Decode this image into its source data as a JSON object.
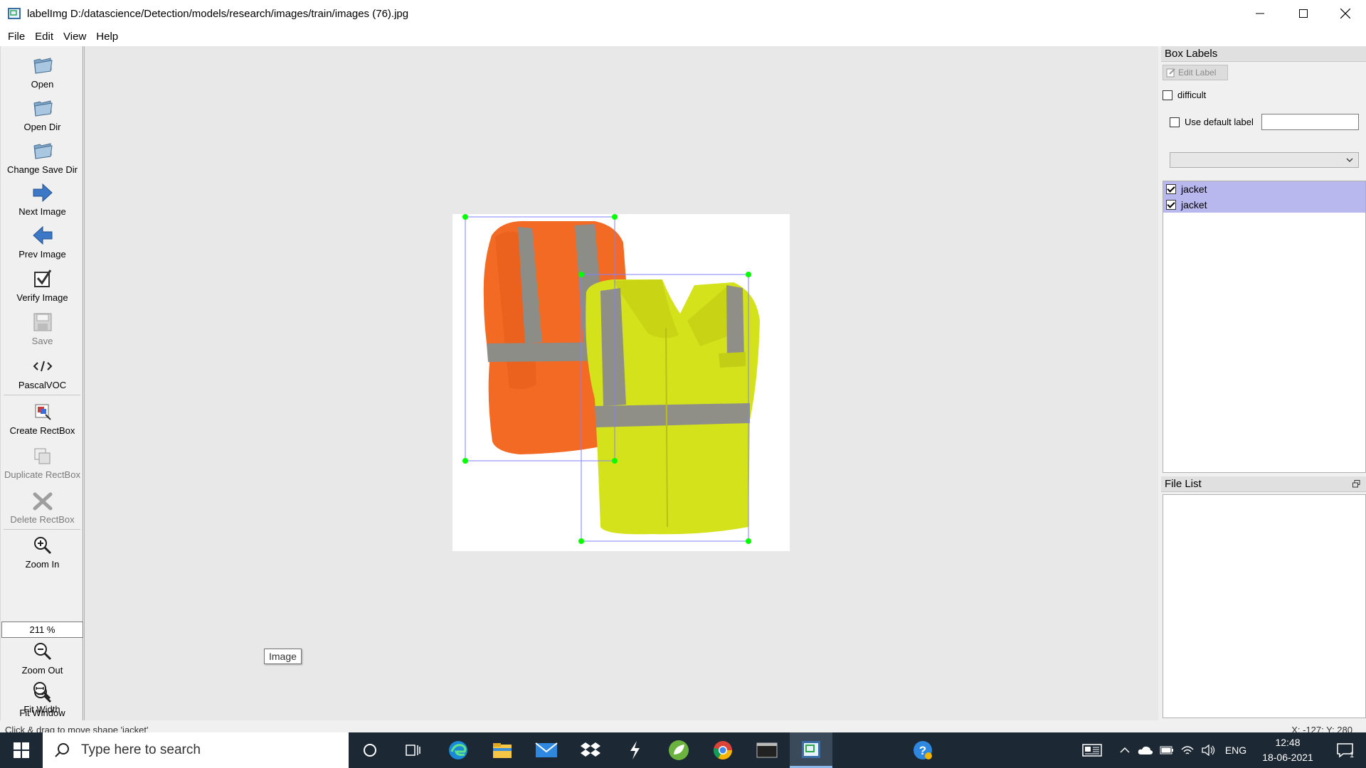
{
  "window": {
    "app_name": "labelImg",
    "title": "labelImg D:/datascience/Detection/models/research/images/train/images (76).jpg"
  },
  "menu": [
    "File",
    "Edit",
    "View",
    "Help"
  ],
  "toolbar": {
    "open": "Open",
    "open_dir": "Open Dir",
    "change_save_dir": "Change Save Dir",
    "next_image": "Next Image",
    "prev_image": "Prev Image",
    "verify_image": "Verify Image",
    "save": "Save",
    "format": "PascalVOC",
    "create_rectbox": "Create RectBox",
    "duplicate_rectbox": "Duplicate RectBox",
    "delete_rectbox": "Delete RectBox",
    "zoom_in": "Zoom In",
    "zoom_value": "211 %",
    "zoom_out": "Zoom Out",
    "fit_window": "Fit Window",
    "fit_width": "Fit Width"
  },
  "canvas": {
    "tooltip": "Image"
  },
  "dock": {
    "box_labels_title": "Box Labels",
    "edit_label": "Edit Label",
    "difficult": "difficult",
    "use_default_label": "Use default label",
    "labels": [
      {
        "name": "jacket",
        "checked": true
      },
      {
        "name": "jacket",
        "checked": true
      }
    ],
    "file_list_title": "File List"
  },
  "status": {
    "message": "Click & drag to move shape 'jacket'",
    "coords": "X: -127; Y: 280"
  },
  "taskbar": {
    "search_placeholder": "Type here to search",
    "language": "ENG",
    "time": "12:48",
    "date": "18-06-2021",
    "notification_count": "1"
  },
  "colors": {
    "box_outline": "#8080ff",
    "vertex": "#00ff00",
    "selected_label_bg": "#b8b8ee",
    "orange_vest": "#f26a24",
    "yellow_vest": "#d4e21c"
  }
}
